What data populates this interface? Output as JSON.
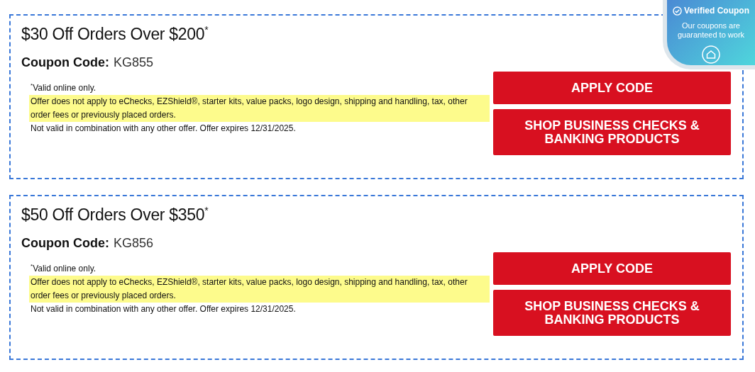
{
  "coupons": [
    {
      "title": "$30 Off Orders Over $200$^{*}$",
      "code_label": "Coupon Code:",
      "code": "KG855",
      "terms": [
        {
          "text": "$^{*}$Valid online only.",
          "highlighted": false
        },
        {
          "text": "Offer does not apply to eChecks, EZShield®, starter kits, value packs, logo design, shipping and handling, tax, other order fees or previously placed orders.",
          "highlighted": true
        },
        {
          "text": "Not valid in combination with any other offer. Offer expires 12/31/2025.",
          "highlighted": false
        }
      ],
      "buttons": [
        "APPLY CODE",
        "SHOP BUSINESS CHECKS & BANKING PRODUCTS"
      ]
    },
    {
      "title": "$50 Off Orders Over $350$^{*}$",
      "code_label": "Coupon Code:",
      "code": "KG856",
      "terms": [
        {
          "text": "$^{*}$Valid online only.",
          "highlighted": false
        },
        {
          "text": "Offer does not apply to eChecks, EZShield®, starter kits, value packs, logo design, shipping and handling, tax, other order fees or previously placed orders.",
          "highlighted": true
        },
        {
          "text": "Not valid in combination with any other offer. Offer expires 12/31/2025.",
          "highlighted": false
        }
      ],
      "buttons": [
        "APPLY CODE",
        "SHOP BUSINESS CHECKS & BANKING PRODUCTS"
      ]
    }
  ],
  "badge": {
    "title": "Verified Coupon",
    "text": "Our coupons are guaranteed to work"
  }
}
